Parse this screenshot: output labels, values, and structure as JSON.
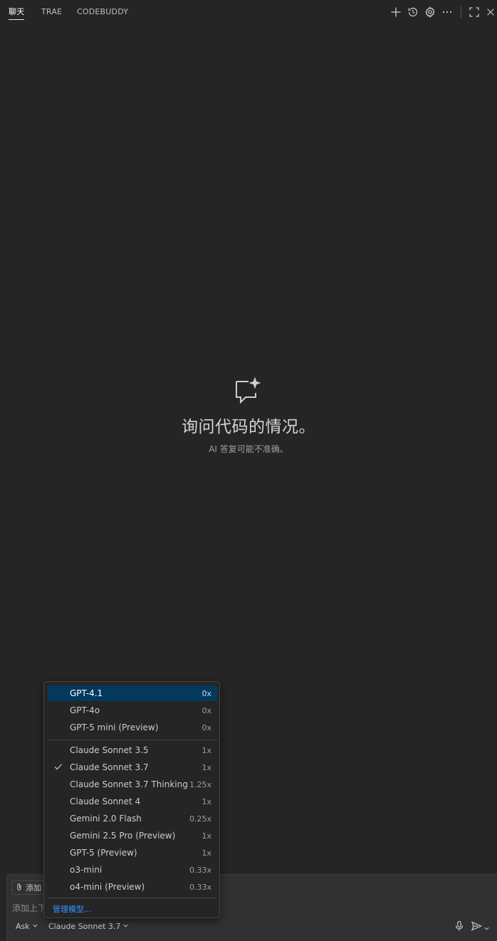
{
  "tabs": [
    {
      "label": "聊天",
      "active": true
    },
    {
      "label": "TRAE",
      "active": false
    },
    {
      "label": "CODEBUDDY",
      "active": false
    }
  ],
  "toolbar_icons": [
    "plus-icon",
    "history-icon",
    "gear-icon",
    "more-icon",
    "maximize-icon",
    "close-icon"
  ],
  "empty_state": {
    "icon": "chat-sparkle-icon",
    "title": "询问代码的情况。",
    "subtitle": "AI 答复可能不准确。"
  },
  "dropdown": {
    "group1": [
      {
        "label": "GPT-4.1",
        "multiplier": "0x",
        "selected": true,
        "checked": false
      },
      {
        "label": "GPT-4o",
        "multiplier": "0x",
        "selected": false,
        "checked": false
      },
      {
        "label": "GPT-5 mini (Preview)",
        "multiplier": "0x",
        "selected": false,
        "checked": false
      }
    ],
    "group2": [
      {
        "label": "Claude Sonnet 3.5",
        "multiplier": "1x",
        "selected": false,
        "checked": false
      },
      {
        "label": "Claude Sonnet 3.7",
        "multiplier": "1x",
        "selected": false,
        "checked": true
      },
      {
        "label": "Claude Sonnet 3.7 Thinking",
        "multiplier": "1.25x",
        "selected": false,
        "checked": false
      },
      {
        "label": "Claude Sonnet 4",
        "multiplier": "1x",
        "selected": false,
        "checked": false
      },
      {
        "label": "Gemini 2.0 Flash",
        "multiplier": "0.25x",
        "selected": false,
        "checked": false
      },
      {
        "label": "Gemini 2.5 Pro (Preview)",
        "multiplier": "1x",
        "selected": false,
        "checked": false
      },
      {
        "label": "GPT-5 (Preview)",
        "multiplier": "1x",
        "selected": false,
        "checked": false
      },
      {
        "label": "o3-mini",
        "multiplier": "0.33x",
        "selected": false,
        "checked": false
      },
      {
        "label": "o4-mini (Preview)",
        "multiplier": "0.33x",
        "selected": false,
        "checked": false
      }
    ],
    "manage_label": "管理模型..."
  },
  "input": {
    "add_context_label": "添加",
    "placeholder": "添加上下",
    "mode": "Ask",
    "model": "Claude Sonnet 3.7"
  },
  "colors": {
    "background": "#252526",
    "selected": "#04395e",
    "link": "#3794ff"
  }
}
